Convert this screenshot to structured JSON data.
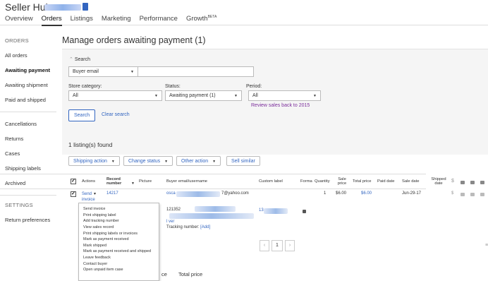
{
  "header": {
    "brand": "Seller Hub",
    "nav": [
      "Overview",
      "Orders",
      "Listings",
      "Marketing",
      "Performance",
      "Growth"
    ],
    "growth_badge": "BETA",
    "active_nav": "Orders"
  },
  "sidebar": {
    "orders_heading": "ORDERS",
    "items": [
      "All orders",
      "Awaiting payment",
      "Awaiting shipment",
      "Paid and shipped"
    ],
    "items2": [
      "Cancellations",
      "Returns",
      "Cases",
      "Shipping labels",
      "Archived"
    ],
    "settings_heading": "SETTINGS",
    "settings_items": [
      "Return preferences"
    ]
  },
  "main": {
    "title": "Manage orders awaiting payment (1)"
  },
  "search": {
    "toggle_label": "Search",
    "field_select": "Buyer email",
    "store_category_label": "Store category:",
    "store_category_value": "All",
    "status_label": "Status:",
    "status_value": "Awaiting payment (1)",
    "period_label": "Period:",
    "period_value": "All",
    "review_link": "Review sales back to 2015",
    "search_button": "Search",
    "clear_link": "Clear search"
  },
  "results": {
    "count": "1 listing(s) found",
    "actions": [
      "Shipping action",
      "Change status",
      "Other action"
    ],
    "sell_similar": "Sell similar"
  },
  "table": {
    "columns": [
      "Actions",
      "Record number",
      "Picture",
      "Buyer email/username",
      "Custom label",
      "Forma",
      "Quantity",
      "Sale price",
      "Total price",
      "Paid date",
      "Sale date",
      "Shipped date"
    ],
    "row": {
      "action": "Send invoice",
      "record": "14217",
      "buyer_start": "osca",
      "buyer_email_end": "7@yahoo.com",
      "buyer_id": "121352",
      "item_suffix": "l ver",
      "custom_label_start": "13",
      "quantity": "1",
      "sale_price": "$6.00",
      "total_price": "$6.00",
      "sale_date": "Jun-29-17",
      "tracking_label": "Tracking number:",
      "tracking_add": "[Add]"
    }
  },
  "menu": {
    "items": [
      "Send invoice",
      "Print shipping label",
      "Add tracking number",
      "View sales record",
      "Print shipping labels or invoices",
      "Mark as payment received",
      "Mark shipped",
      "Mark as payment received and shipped",
      "Leave feedback",
      "Contact buyer",
      "Open unpaid item case"
    ]
  },
  "pager": {
    "current": "1",
    "prev": "‹",
    "next": "›"
  },
  "footer": {
    "col1_fragment": "ce",
    "col2": "Total price"
  }
}
